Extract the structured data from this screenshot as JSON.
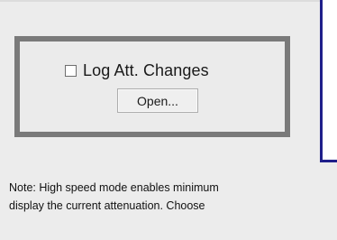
{
  "logging_group": {
    "checkbox": {
      "label": "Log Att. Changes",
      "checked": false
    },
    "open_button_label": "Open..."
  },
  "note": {
    "line1": "Note: High speed mode enables minimum",
    "line2": "display the current attenuation. Choose"
  },
  "colors": {
    "background": "#ececec",
    "frame": "#7a7a7a",
    "panel_border": "#1f1f8a"
  }
}
